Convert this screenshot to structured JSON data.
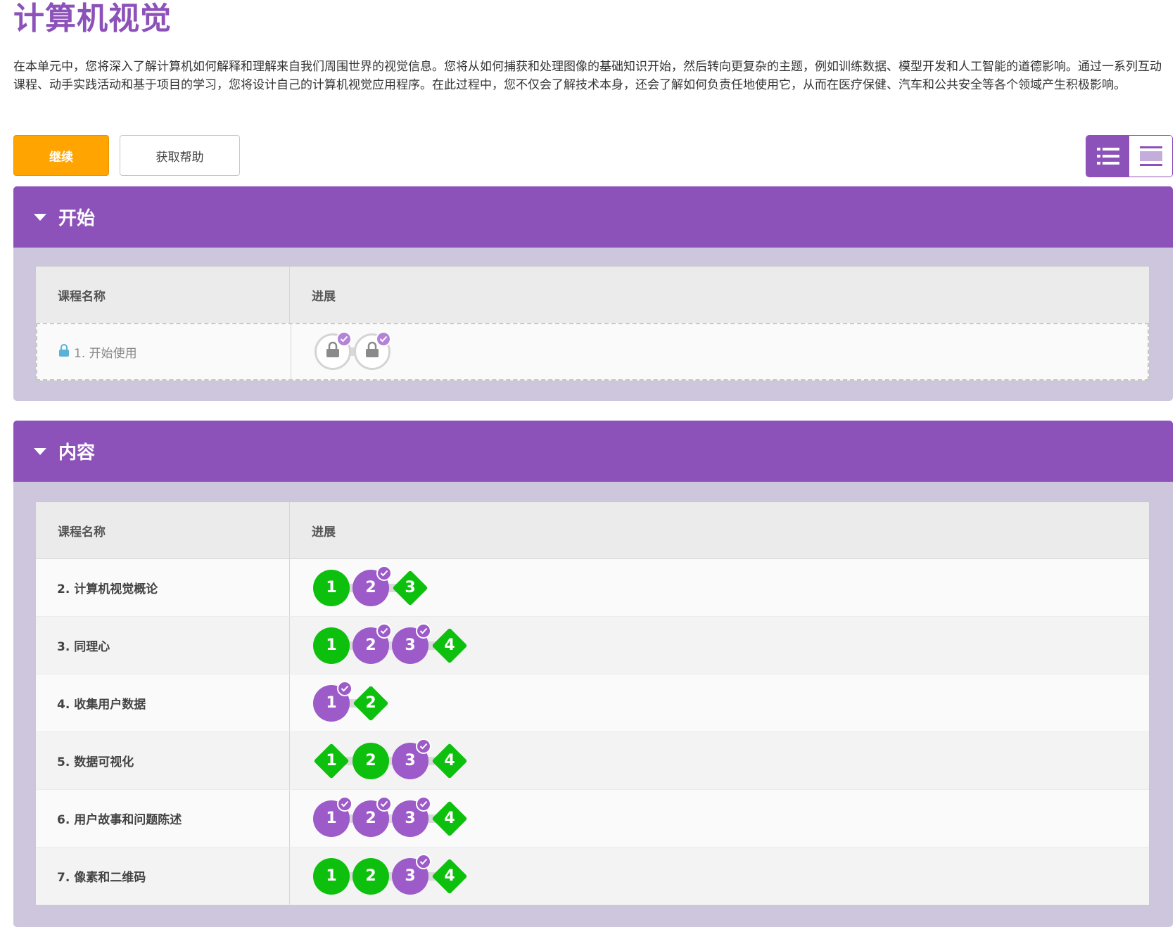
{
  "page": {
    "title": "计算机视觉",
    "description": "在本单元中，您将深入了解计算机如何解释和理解来自我们周围世界的视觉信息。您将从如何捕获和处理图像的基础知识开始，然后转向更复杂的主题，例如训练数据、模型开发和人工智能的道德影响。通过一系列互动课程、动手实践活动和基于项目的学习，您将设计自己的计算机视觉应用程序。在此过程中，您不仅会了解技术本身，还会了解如何负责任地使用它，从而在医疗保健、汽车和公共安全等各个领域产生积极影响。"
  },
  "actions": {
    "continue_label": "继续",
    "help_label": "获取帮助"
  },
  "colors": {
    "brand": "#8c52ba",
    "continue": "#ffa400",
    "complete": "#0ec00e",
    "section_bg": "#cdc6dd"
  },
  "sections": [
    {
      "title": "开始",
      "headers": [
        "课程名称",
        "进展"
      ],
      "lessons": [
        {
          "name": "1. 开始使用",
          "locked": true,
          "steps": [
            {
              "label": "",
              "kind": "lock",
              "checked": true
            },
            {
              "label": "",
              "kind": "lock",
              "checked": true
            }
          ]
        }
      ]
    },
    {
      "title": "内容",
      "headers": [
        "课程名称",
        "进展"
      ],
      "lessons": [
        {
          "name": "2. 计算机视觉概论",
          "steps": [
            {
              "label": "1",
              "kind": "green-circle",
              "checked": false
            },
            {
              "label": "2",
              "kind": "purple-circle",
              "checked": true
            },
            {
              "label": "3",
              "kind": "green-diamond",
              "checked": false
            }
          ]
        },
        {
          "name": "3. 同理心",
          "steps": [
            {
              "label": "1",
              "kind": "green-circle",
              "checked": false
            },
            {
              "label": "2",
              "kind": "purple-circle",
              "checked": true
            },
            {
              "label": "3",
              "kind": "purple-circle",
              "checked": true
            },
            {
              "label": "4",
              "kind": "green-diamond",
              "checked": false
            }
          ]
        },
        {
          "name": "4. 收集用户数据",
          "steps": [
            {
              "label": "1",
              "kind": "purple-circle",
              "checked": true
            },
            {
              "label": "2",
              "kind": "green-diamond",
              "checked": false
            }
          ]
        },
        {
          "name": "5. 数据可视化",
          "steps": [
            {
              "label": "1",
              "kind": "green-diamond",
              "checked": false
            },
            {
              "label": "2",
              "kind": "green-circle",
              "checked": false
            },
            {
              "label": "3",
              "kind": "purple-circle",
              "checked": true
            },
            {
              "label": "4",
              "kind": "green-diamond",
              "checked": false
            }
          ]
        },
        {
          "name": "6. 用户故事和问题陈述",
          "steps": [
            {
              "label": "1",
              "kind": "purple-circle",
              "checked": true
            },
            {
              "label": "2",
              "kind": "purple-circle",
              "checked": true
            },
            {
              "label": "3",
              "kind": "purple-circle",
              "checked": true
            },
            {
              "label": "4",
              "kind": "green-diamond",
              "checked": false
            }
          ]
        },
        {
          "name": "7. 像素和二维码",
          "steps": [
            {
              "label": "1",
              "kind": "green-circle",
              "checked": false
            },
            {
              "label": "2",
              "kind": "green-circle",
              "checked": false
            },
            {
              "label": "3",
              "kind": "purple-circle",
              "checked": true
            },
            {
              "label": "4",
              "kind": "green-diamond",
              "checked": false
            }
          ]
        }
      ]
    }
  ]
}
